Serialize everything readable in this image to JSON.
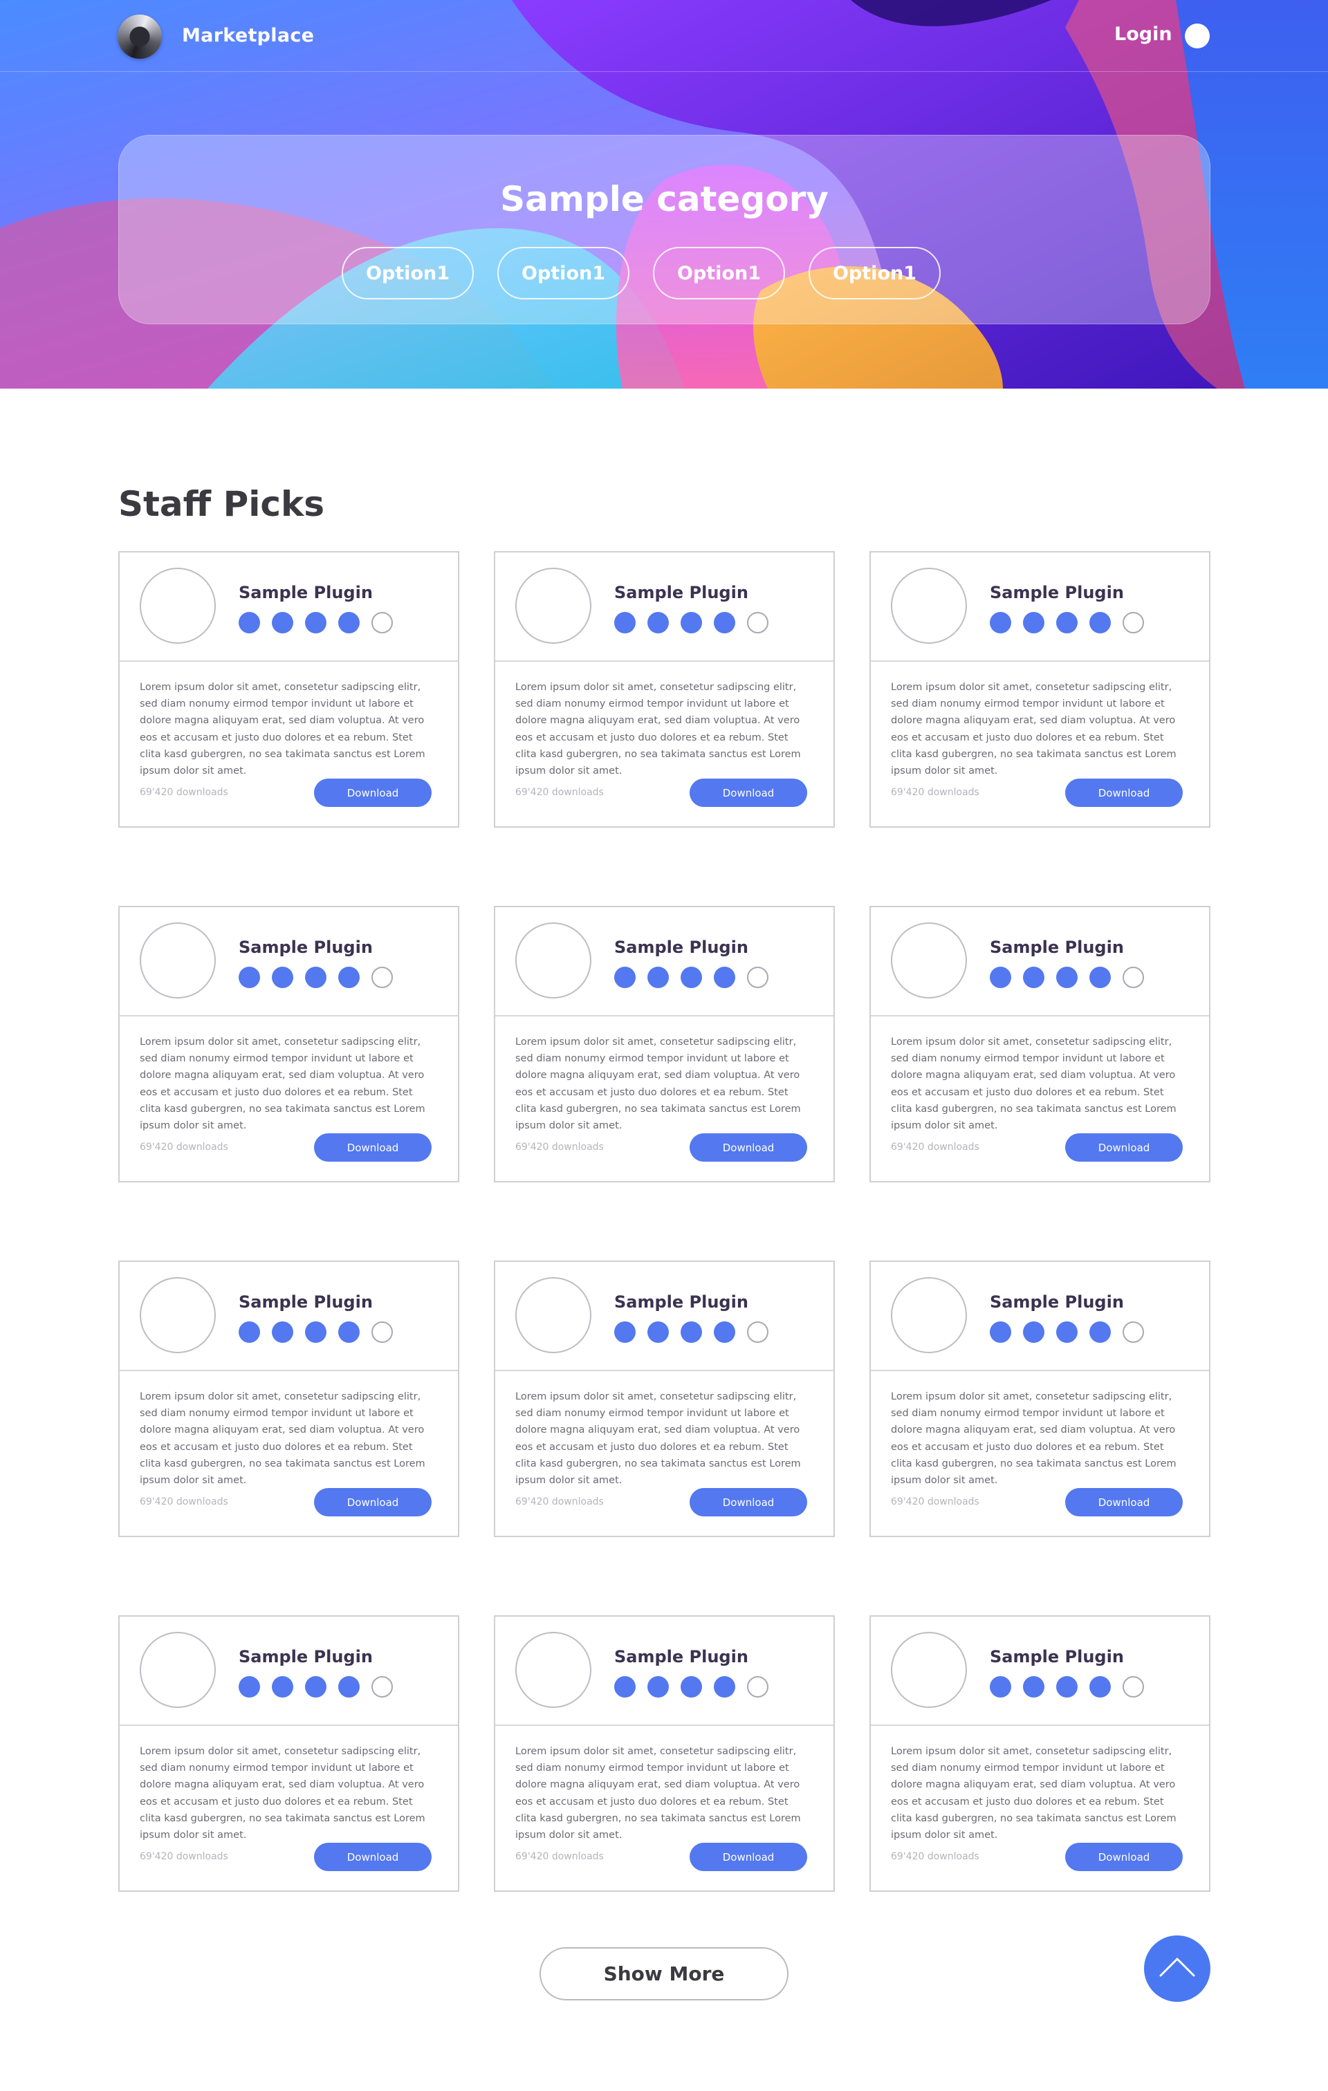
{
  "header": {
    "brand": "Marketplace",
    "login_label": "Login"
  },
  "hero": {
    "category_title": "Sample category",
    "options": [
      "Option1",
      "Option1",
      "Option1",
      "Option1"
    ]
  },
  "section": {
    "title": "Staff Picks"
  },
  "cards": [
    {
      "name": "Sample Plugin",
      "rating": 4,
      "rating_max": 5,
      "description": "Lorem ipsum dolor sit amet, consetetur sadipscing elitr, sed diam nonumy eirmod tempor invidunt ut labore et dolore magna aliquyam erat, sed diam voluptua. At vero eos et accusam et justo duo dolores et ea rebum. Stet clita kasd gubergren, no sea takimata sanctus est Lorem ipsum dolor sit amet.",
      "downloads": "69'420 downloads",
      "button": "Download"
    },
    {
      "name": "Sample Plugin",
      "rating": 4,
      "rating_max": 5,
      "description": "Lorem ipsum dolor sit amet, consetetur sadipscing elitr, sed diam nonumy eirmod tempor invidunt ut labore et dolore magna aliquyam erat, sed diam voluptua. At vero eos et accusam et justo duo dolores et ea rebum. Stet clita kasd gubergren, no sea takimata sanctus est Lorem ipsum dolor sit amet.",
      "downloads": "69'420 downloads",
      "button": "Download"
    },
    {
      "name": "Sample Plugin",
      "rating": 4,
      "rating_max": 5,
      "description": "Lorem ipsum dolor sit amet, consetetur sadipscing elitr, sed diam nonumy eirmod tempor invidunt ut labore et dolore magna aliquyam erat, sed diam voluptua. At vero eos et accusam et justo duo dolores et ea rebum. Stet clita kasd gubergren, no sea takimata sanctus est Lorem ipsum dolor sit amet.",
      "downloads": "69'420 downloads",
      "button": "Download"
    },
    {
      "name": "Sample Plugin",
      "rating": 4,
      "rating_max": 5,
      "description": "Lorem ipsum dolor sit amet, consetetur sadipscing elitr, sed diam nonumy eirmod tempor invidunt ut labore et dolore magna aliquyam erat, sed diam voluptua. At vero eos et accusam et justo duo dolores et ea rebum. Stet clita kasd gubergren, no sea takimata sanctus est Lorem ipsum dolor sit amet.",
      "downloads": "69'420 downloads",
      "button": "Download"
    },
    {
      "name": "Sample Plugin",
      "rating": 4,
      "rating_max": 5,
      "description": "Lorem ipsum dolor sit amet, consetetur sadipscing elitr, sed diam nonumy eirmod tempor invidunt ut labore et dolore magna aliquyam erat, sed diam voluptua. At vero eos et accusam et justo duo dolores et ea rebum. Stet clita kasd gubergren, no sea takimata sanctus est Lorem ipsum dolor sit amet.",
      "downloads": "69'420 downloads",
      "button": "Download"
    },
    {
      "name": "Sample Plugin",
      "rating": 4,
      "rating_max": 5,
      "description": "Lorem ipsum dolor sit amet, consetetur sadipscing elitr, sed diam nonumy eirmod tempor invidunt ut labore et dolore magna aliquyam erat, sed diam voluptua. At vero eos et accusam et justo duo dolores et ea rebum. Stet clita kasd gubergren, no sea takimata sanctus est Lorem ipsum dolor sit amet.",
      "downloads": "69'420 downloads",
      "button": "Download"
    },
    {
      "name": "Sample Plugin",
      "rating": 4,
      "rating_max": 5,
      "description": "Lorem ipsum dolor sit amet, consetetur sadipscing elitr, sed diam nonumy eirmod tempor invidunt ut labore et dolore magna aliquyam erat, sed diam voluptua. At vero eos et accusam et justo duo dolores et ea rebum. Stet clita kasd gubergren, no sea takimata sanctus est Lorem ipsum dolor sit amet.",
      "downloads": "69'420 downloads",
      "button": "Download"
    },
    {
      "name": "Sample Plugin",
      "rating": 4,
      "rating_max": 5,
      "description": "Lorem ipsum dolor sit amet, consetetur sadipscing elitr, sed diam nonumy eirmod tempor invidunt ut labore et dolore magna aliquyam erat, sed diam voluptua. At vero eos et accusam et justo duo dolores et ea rebum. Stet clita kasd gubergren, no sea takimata sanctus est Lorem ipsum dolor sit amet.",
      "downloads": "69'420 downloads",
      "button": "Download"
    },
    {
      "name": "Sample Plugin",
      "rating": 4,
      "rating_max": 5,
      "description": "Lorem ipsum dolor sit amet, consetetur sadipscing elitr, sed diam nonumy eirmod tempor invidunt ut labore et dolore magna aliquyam erat, sed diam voluptua. At vero eos et accusam et justo duo dolores et ea rebum. Stet clita kasd gubergren, no sea takimata sanctus est Lorem ipsum dolor sit amet.",
      "downloads": "69'420 downloads",
      "button": "Download"
    },
    {
      "name": "Sample Plugin",
      "rating": 4,
      "rating_max": 5,
      "description": "Lorem ipsum dolor sit amet, consetetur sadipscing elitr, sed diam nonumy eirmod tempor invidunt ut labore et dolore magna aliquyam erat, sed diam voluptua. At vero eos et accusam et justo duo dolores et ea rebum. Stet clita kasd gubergren, no sea takimata sanctus est Lorem ipsum dolor sit amet.",
      "downloads": "69'420 downloads",
      "button": "Download"
    },
    {
      "name": "Sample Plugin",
      "rating": 4,
      "rating_max": 5,
      "description": "Lorem ipsum dolor sit amet, consetetur sadipscing elitr, sed diam nonumy eirmod tempor invidunt ut labore et dolore magna aliquyam erat, sed diam voluptua. At vero eos et accusam et justo duo dolores et ea rebum. Stet clita kasd gubergren, no sea takimata sanctus est Lorem ipsum dolor sit amet.",
      "downloads": "69'420 downloads",
      "button": "Download"
    },
    {
      "name": "Sample Plugin",
      "rating": 4,
      "rating_max": 5,
      "description": "Lorem ipsum dolor sit amet, consetetur sadipscing elitr, sed diam nonumy eirmod tempor invidunt ut labore et dolore magna aliquyam erat, sed diam voluptua. At vero eos et accusam et justo duo dolores et ea rebum. Stet clita kasd gubergren, no sea takimata sanctus est Lorem ipsum dolor sit amet.",
      "downloads": "69'420 downloads",
      "button": "Download"
    }
  ],
  "footer": {
    "show_more_label": "Show More",
    "scroll_top_icon": "chevron-up-icon"
  },
  "colors": {
    "accent": "#5378ef",
    "scroll_top": "#4a78f2"
  }
}
